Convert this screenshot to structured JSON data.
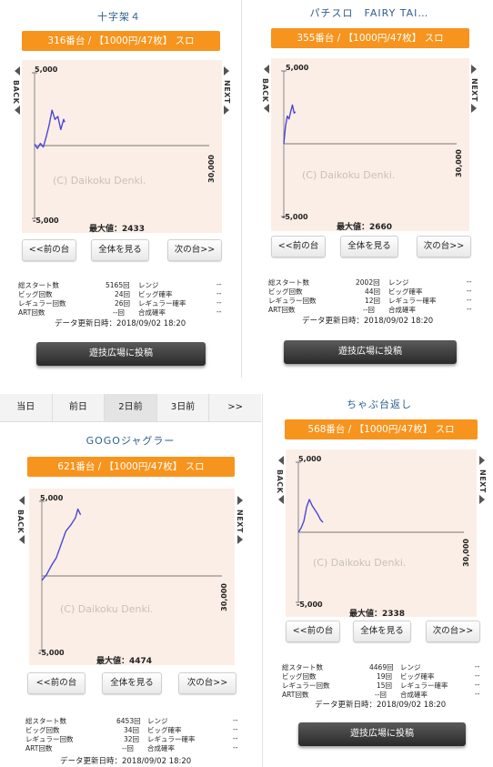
{
  "tabs": [
    "当日",
    "前日",
    "2日前",
    "3日前",
    ">>"
  ],
  "common": {
    "back": "BACK",
    "next": "NEXT",
    "y_top": "5,000",
    "y_bottom": "-5,000",
    "x_tick": "30,000",
    "watermark": "(C) Daikoku Denki.",
    "btn_prev": "<<前の台",
    "btn_all": "全体を見る",
    "btn_next": "次の台>>",
    "post_button": "遊技広場に投稿",
    "updated": "データ更新日時：2018/09/02 18:20",
    "labels": {
      "total_start": "総スタート数",
      "big_count": "ビッグ回数",
      "reg_count": "レギュラー回数",
      "art_count": "ART回数",
      "range": "レンジ",
      "big_prob": "ビッグ確率",
      "reg_prob": "レギュラー確率",
      "combined_prob": "合成確率",
      "dash": "--"
    }
  },
  "panels": [
    {
      "title": "十字架４",
      "bar": "316番台 / 【1000円/47枚】 スロ",
      "max": "最大値：2433",
      "total_start": "5165回",
      "big": "24回",
      "reg": "26回",
      "art": "--回",
      "chart_data": {
        "type": "line",
        "ylim": [
          -5000,
          5000
        ],
        "xlim": [
          0,
          30000
        ],
        "x": [
          0,
          500,
          1000,
          1500,
          2000,
          2500,
          3000,
          3500,
          4000,
          4500,
          5000,
          5165
        ],
        "y": [
          100,
          -200,
          150,
          -100,
          600,
          1400,
          2433,
          1800,
          2000,
          1100,
          1800,
          1600
        ]
      }
    },
    {
      "title": "パチスロ　FAIRY TAI…",
      "bar": "355番台 / 【1000円/47枚】 スロ",
      "max": "最大値：2660",
      "total_start": "2002回",
      "big": "44回",
      "reg": "12回",
      "art": "--回",
      "chart_data": {
        "type": "line",
        "ylim": [
          -5000,
          5000
        ],
        "xlim": [
          0,
          30000
        ],
        "x": [
          0,
          300,
          600,
          900,
          1200,
          1500,
          1800,
          2002
        ],
        "y": [
          0,
          1200,
          1900,
          1700,
          2200,
          2660,
          2100,
          2200
        ]
      }
    },
    {
      "title": "GOGOジャグラー",
      "bar": "621番台 / 【1000円/47枚】 スロ",
      "max": "最大値：4474",
      "total_start": "6453回",
      "big": "34回",
      "reg": "32回",
      "art": "--回",
      "chart_data": {
        "type": "line",
        "ylim": [
          -5000,
          5000
        ],
        "xlim": [
          0,
          30000
        ],
        "x": [
          0,
          800,
          1600,
          2400,
          3200,
          4000,
          4800,
          5600,
          6000,
          6453
        ],
        "y": [
          -300,
          100,
          700,
          1200,
          2100,
          3000,
          3400,
          3900,
          4474,
          4100
        ]
      }
    },
    {
      "title": "ちゃぶ台返し",
      "bar": "568番台 / 【1000円/47枚】 スロ",
      "max": "最大値：2338",
      "total_start": "4469回",
      "big": "19回",
      "reg": "15回",
      "art": "--回",
      "chart_data": {
        "type": "line",
        "ylim": [
          -5000,
          5000
        ],
        "xlim": [
          0,
          30000
        ],
        "x": [
          0,
          500,
          1000,
          1500,
          2000,
          2500,
          3000,
          3500,
          4000,
          4469
        ],
        "y": [
          0,
          300,
          800,
          1800,
          2338,
          1900,
          1600,
          1300,
          900,
          700
        ]
      }
    }
  ]
}
